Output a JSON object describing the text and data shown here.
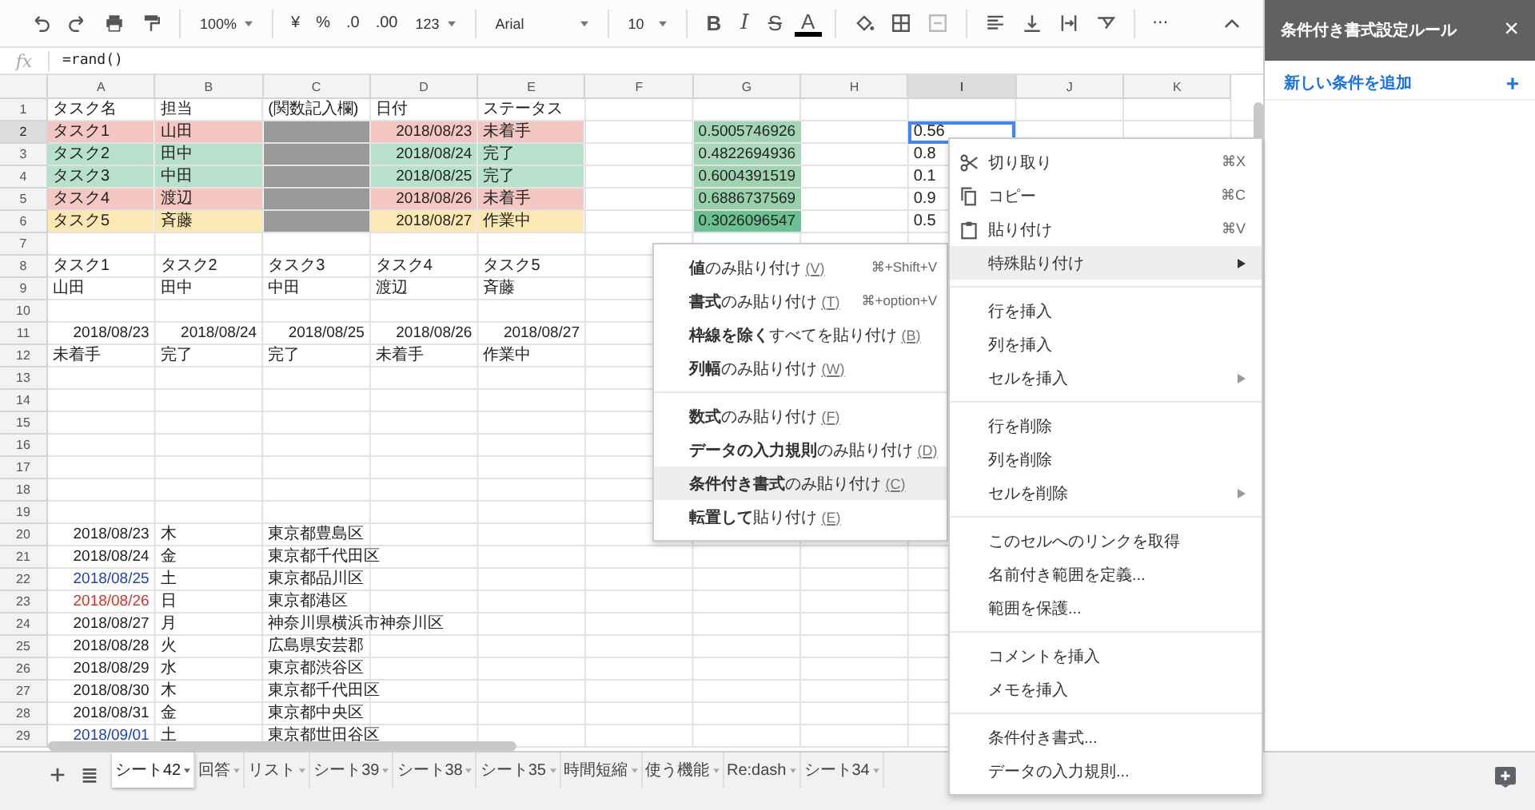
{
  "toolbar": {
    "zoom": "100%",
    "currency": "¥",
    "percent": "%",
    "decimal_less": ".0",
    "decimal_more": ".00",
    "number_format": "123",
    "font": "Arial",
    "font_size": "10",
    "bold": "B",
    "italic": "I",
    "strikethrough": "S",
    "text_color": "A",
    "more": "⋯"
  },
  "formula_bar": {
    "label": "fx",
    "value": "=rand()"
  },
  "columns": [
    {
      "label": "A",
      "selected": false
    },
    {
      "label": "B",
      "selected": false
    },
    {
      "label": "C",
      "selected": false
    },
    {
      "label": "D",
      "selected": false
    },
    {
      "label": "E",
      "selected": false
    },
    {
      "label": "F",
      "selected": false
    },
    {
      "label": "G",
      "selected": false
    },
    {
      "label": "H",
      "selected": false
    },
    {
      "label": "I",
      "selected": true
    },
    {
      "label": "J",
      "selected": false
    },
    {
      "label": "K",
      "selected": false
    }
  ],
  "rows": [
    {
      "number": "1",
      "selected": false,
      "cells": [
        {
          "text": "タスク名",
          "kind": "text"
        },
        {
          "text": "担当",
          "kind": "text"
        },
        {
          "text": "(関数記入欄)",
          "kind": "text"
        },
        {
          "text": "日付",
          "kind": "text"
        },
        {
          "text": "ステータス",
          "kind": "text"
        }
      ]
    },
    {
      "number": "2",
      "selected": true,
      "cells": [
        {
          "text": "タスク1",
          "kind": "text",
          "color": "#f4c7c3"
        },
        {
          "text": "山田",
          "kind": "text",
          "color": "#f4c7c3"
        },
        {
          "kind": "blank",
          "color": "#999999"
        },
        {
          "text": "2018/08/23",
          "kind": "num",
          "color": "#f4c7c3"
        },
        {
          "text": "未着手",
          "kind": "text",
          "color": "#f4c7c3"
        },
        null,
        {
          "text": "0.5005746926",
          "kind": "num",
          "color": "#a3d5b5"
        },
        null,
        {
          "text": "0.56",
          "kind": "text"
        }
      ]
    },
    {
      "number": "3",
      "selected": false,
      "cells": [
        {
          "text": "タスク2",
          "kind": "text",
          "color": "#b7e1cd"
        },
        {
          "text": "田中",
          "kind": "text",
          "color": "#b7e1cd"
        },
        {
          "kind": "blank",
          "color": "#999999"
        },
        {
          "text": "2018/08/24",
          "kind": "num",
          "color": "#b7e1cd"
        },
        {
          "text": "完了",
          "kind": "text",
          "color": "#b7e1cd"
        },
        null,
        {
          "text": "0.4822694936",
          "kind": "num",
          "color": "#a8d8b9"
        },
        null,
        {
          "text": "0.8",
          "kind": "text"
        }
      ]
    },
    {
      "number": "4",
      "selected": false,
      "cells": [
        {
          "text": "タスク3",
          "kind": "text",
          "color": "#b7e1cd"
        },
        {
          "text": "中田",
          "kind": "text",
          "color": "#b7e1cd"
        },
        {
          "kind": "blank",
          "color": "#999999"
        },
        {
          "text": "2018/08/25",
          "kind": "num",
          "color": "#b7e1cd"
        },
        {
          "text": "完了",
          "kind": "text",
          "color": "#b7e1cd"
        },
        null,
        {
          "text": "0.6004391519",
          "kind": "num",
          "color": "#9fd3b1"
        },
        null,
        {
          "text": "0.1",
          "kind": "text"
        }
      ]
    },
    {
      "number": "5",
      "selected": false,
      "cells": [
        {
          "text": "タスク4",
          "kind": "text",
          "color": "#f4c7c3"
        },
        {
          "text": "渡辺",
          "kind": "text",
          "color": "#f4c7c3"
        },
        {
          "kind": "blank",
          "color": "#999999"
        },
        {
          "text": "2018/08/26",
          "kind": "num",
          "color": "#f4c7c3"
        },
        {
          "text": "未着手",
          "kind": "text",
          "color": "#f4c7c3"
        },
        null,
        {
          "text": "0.6886737569",
          "kind": "num",
          "color": "#98d0ab"
        },
        null,
        {
          "text": "0.9",
          "kind": "text"
        }
      ]
    },
    {
      "number": "6",
      "selected": false,
      "cells": [
        {
          "text": "タスク5",
          "kind": "text",
          "color": "#fce8b2"
        },
        {
          "text": "斉藤",
          "kind": "text",
          "color": "#fce8b2"
        },
        {
          "kind": "blank",
          "color": "#999999"
        },
        {
          "text": "2018/08/27",
          "kind": "num",
          "color": "#fce8b2"
        },
        {
          "text": "作業中",
          "kind": "text",
          "color": "#fce8b2"
        },
        null,
        {
          "text": "0.3026096547",
          "kind": "num",
          "color": "#6cc091"
        },
        null,
        {
          "text": "0.5",
          "kind": "text"
        }
      ]
    },
    {
      "number": "7",
      "selected": false
    },
    {
      "number": "8",
      "selected": false,
      "cells": [
        {
          "text": "タスク1",
          "kind": "text"
        },
        {
          "text": "タスク2",
          "kind": "text"
        },
        {
          "text": "タスク3",
          "kind": "text"
        },
        {
          "text": "タスク4",
          "kind": "text"
        },
        {
          "text": "タスク5",
          "kind": "text"
        }
      ]
    },
    {
      "number": "9",
      "selected": false,
      "cells": [
        {
          "text": "山田",
          "kind": "text"
        },
        {
          "text": "田中",
          "kind": "text"
        },
        {
          "text": "中田",
          "kind": "text"
        },
        {
          "text": "渡辺",
          "kind": "text"
        },
        {
          "text": "斉藤",
          "kind": "text"
        }
      ]
    },
    {
      "number": "10",
      "selected": false
    },
    {
      "number": "11",
      "selected": false,
      "cells": [
        {
          "text": "2018/08/23",
          "kind": "num"
        },
        {
          "text": "2018/08/24",
          "kind": "num"
        },
        {
          "text": "2018/08/25",
          "kind": "num"
        },
        {
          "text": "2018/08/26",
          "kind": "num"
        },
        {
          "text": "2018/08/27",
          "kind": "num"
        }
      ]
    },
    {
      "number": "12",
      "selected": false,
      "cells": [
        {
          "text": "未着手",
          "kind": "text"
        },
        {
          "text": "完了",
          "kind": "text"
        },
        {
          "text": "完了",
          "kind": "text"
        },
        {
          "text": "未着手",
          "kind": "text"
        },
        {
          "text": "作業中",
          "kind": "text"
        }
      ]
    },
    {
      "number": "13",
      "selected": false
    },
    {
      "number": "14",
      "selected": false
    },
    {
      "number": "15",
      "selected": false
    },
    {
      "number": "16",
      "selected": false
    },
    {
      "number": "17",
      "selected": false
    },
    {
      "number": "18",
      "selected": false
    },
    {
      "number": "19",
      "selected": false
    },
    {
      "number": "20",
      "selected": false,
      "cells": [
        {
          "text": "2018/08/23",
          "kind": "num"
        },
        {
          "text": "木",
          "kind": "text"
        },
        {
          "text": "東京都豊島区",
          "kind": "text"
        }
      ]
    },
    {
      "number": "21",
      "selected": false,
      "cells": [
        {
          "text": "2018/08/24",
          "kind": "num"
        },
        {
          "text": "金",
          "kind": "text"
        },
        {
          "text": "東京都千代田区",
          "kind": "text"
        }
      ]
    },
    {
      "number": "22",
      "selected": false,
      "cells": [
        {
          "text": "2018/08/25",
          "kind": "sat"
        },
        {
          "text": "土",
          "kind": "text"
        },
        {
          "text": "東京都品川区",
          "kind": "text"
        }
      ]
    },
    {
      "number": "23",
      "selected": false,
      "cells": [
        {
          "text": "2018/08/26",
          "kind": "sun"
        },
        {
          "text": "日",
          "kind": "text"
        },
        {
          "text": "東京都港区",
          "kind": "text"
        }
      ]
    },
    {
      "number": "24",
      "selected": false,
      "cells": [
        {
          "text": "2018/08/27",
          "kind": "num"
        },
        {
          "text": "月",
          "kind": "text"
        },
        {
          "text": "神奈川県横浜市神奈川区",
          "kind": "text"
        }
      ]
    },
    {
      "number": "25",
      "selected": false,
      "cells": [
        {
          "text": "2018/08/28",
          "kind": "num"
        },
        {
          "text": "火",
          "kind": "text"
        },
        {
          "text": "広島県安芸郡",
          "kind": "text"
        }
      ]
    },
    {
      "number": "26",
      "selected": false,
      "cells": [
        {
          "text": "2018/08/29",
          "kind": "num"
        },
        {
          "text": "水",
          "kind": "text"
        },
        {
          "text": "東京都渋谷区",
          "kind": "text"
        }
      ]
    },
    {
      "number": "27",
      "selected": false,
      "cells": [
        {
          "text": "2018/08/30",
          "kind": "num"
        },
        {
          "text": "木",
          "kind": "text"
        },
        {
          "text": "東京都千代田区",
          "kind": "text"
        }
      ]
    },
    {
      "number": "28",
      "selected": false,
      "cells": [
        {
          "text": "2018/08/31",
          "kind": "num"
        },
        {
          "text": "金",
          "kind": "text"
        },
        {
          "text": "東京都中央区",
          "kind": "text"
        }
      ]
    },
    {
      "number": "29",
      "selected": false,
      "cells": [
        {
          "text": "2018/09/01",
          "kind": "sat"
        },
        {
          "text": "土",
          "kind": "text"
        },
        {
          "text": "東京都世田谷区",
          "kind": "text"
        }
      ]
    }
  ],
  "context_menu": {
    "groups": [
      [
        {
          "kind": "cut",
          "label": "切り取り",
          "shortcut": "⌘X",
          "submenu": false,
          "highlighted": false
        },
        {
          "kind": "copy",
          "label": "コピー",
          "shortcut": "⌘C",
          "submenu": false,
          "highlighted": false
        },
        {
          "kind": "paste",
          "label": "貼り付け",
          "shortcut": "⌘V",
          "submenu": false,
          "highlighted": false
        },
        {
          "kind": "plain",
          "label": "特殊貼り付け",
          "submenu": true,
          "highlighted": true
        }
      ],
      [
        {
          "kind": "plain",
          "label": "行を挿入",
          "submenu": false,
          "highlighted": false
        },
        {
          "kind": "plain",
          "label": "列を挿入",
          "submenu": false,
          "highlighted": false
        },
        {
          "kind": "plain",
          "label": "セルを挿入",
          "submenu": true,
          "highlighted": false
        }
      ],
      [
        {
          "kind": "plain",
          "label": "行を削除",
          "submenu": false,
          "highlighted": false
        },
        {
          "kind": "plain",
          "label": "列を削除",
          "submenu": false,
          "highlighted": false
        },
        {
          "kind": "plain",
          "label": "セルを削除",
          "submenu": true,
          "highlighted": false
        }
      ],
      [
        {
          "kind": "plain",
          "label": "このセルへのリンクを取得",
          "submenu": false,
          "highlighted": false
        },
        {
          "kind": "plain",
          "label": "名前付き範囲を定義...",
          "submenu": false,
          "highlighted": false
        },
        {
          "kind": "plain",
          "label": "範囲を保護...",
          "submenu": false,
          "highlighted": false
        }
      ],
      [
        {
          "kind": "plain",
          "label": "コメントを挿入",
          "submenu": false,
          "highlighted": false
        },
        {
          "kind": "plain",
          "label": "メモを挿入",
          "submenu": false,
          "highlighted": false
        }
      ],
      [
        {
          "kind": "plain",
          "label": "条件付き書式...",
          "submenu": false,
          "highlighted": false
        },
        {
          "kind": "plain",
          "label": "データの入力規則...",
          "submenu": false,
          "highlighted": false
        }
      ]
    ]
  },
  "paste_special_menu": {
    "groups": [
      [
        {
          "label": "**値**のみ貼り付け",
          "mnemonic": "(V)",
          "shortcut": "⌘+Shift+V",
          "highlighted": false
        },
        {
          "label": "**書式**のみ貼り付け",
          "mnemonic": "(T)",
          "shortcut": "⌘+option+V",
          "highlighted": false
        },
        {
          "label": "**枠線を除く**すべてを貼り付け",
          "mnemonic": "(B)",
          "highlighted": false
        },
        {
          "label": "**列幅**のみ貼り付け",
          "mnemonic": "(W)",
          "highlighted": false
        }
      ],
      [
        {
          "label": "**数式**のみ貼り付け",
          "mnemonic": "(F)",
          "highlighted": false
        },
        {
          "label": "**データの入力規則**のみ貼り付け",
          "mnemonic": "(D)",
          "highlighted": false
        },
        {
          "label": "**条件付き書式**のみ貼り付け",
          "mnemonic": "(C)",
          "highlighted": true
        },
        {
          "label": "**転置して**貼り付け",
          "mnemonic": "(E)",
          "highlighted": false
        }
      ]
    ]
  },
  "side_panel": {
    "title": "条件付き書式設定ルール",
    "close": "×",
    "add_rule": "新しい条件を追加",
    "add_icon": "+"
  },
  "sheet_tabs": [
    {
      "label": "シート42",
      "selected": true
    },
    {
      "label": "回答",
      "selected": false
    },
    {
      "label": "リスト",
      "selected": false
    },
    {
      "label": "シート39",
      "selected": false
    },
    {
      "label": "シート38",
      "selected": false
    },
    {
      "label": "シート35",
      "selected": false
    },
    {
      "label": "時間短縮",
      "selected": false
    },
    {
      "label": "使う機能",
      "selected": false
    },
    {
      "label": "Re:dash",
      "selected": false
    },
    {
      "label": "シート34",
      "selected": false
    }
  ]
}
